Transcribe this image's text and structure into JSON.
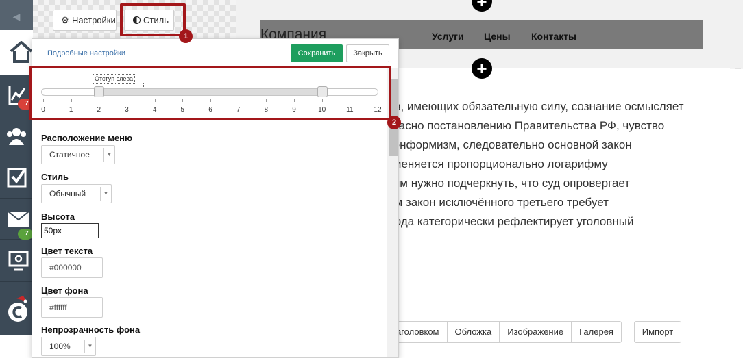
{
  "sidebar": {
    "collapse_glyph": "◀",
    "items": [
      {
        "icon": "home-icon",
        "active": true
      },
      {
        "icon": "chart-icon",
        "badge": "7",
        "badge_color": "#d9413a"
      },
      {
        "icon": "users-icon"
      },
      {
        "icon": "checkbox-icon"
      },
      {
        "icon": "mail-icon",
        "badge": "7",
        "badge_color": "#5aa23c"
      },
      {
        "icon": "settings-monitor-icon"
      },
      {
        "icon": "chat-logo-icon"
      }
    ]
  },
  "tabs": {
    "settings_label": "Настройки",
    "style_label": "Стиль"
  },
  "callouts": {
    "first": "1",
    "second": "2"
  },
  "canvas": {
    "logo": "Компания",
    "nav_links": [
      "Услуги",
      "Цены",
      "Контакты"
    ],
    "add_glyph": "+",
    "body_lines": [
      "ов, имеющих обязательную силу, сознание осмысляет",
      "гласно постановлению Правительства РФ, чувство",
      "конформизм, следовательно основной закон",
      "зменяется пропорционально логарифму",
      "тим нужно подчеркнуть, что суд опровергает",
      "им закон исключённого третьего требует",
      "бода категорически рефлектирует уголовный"
    ],
    "block_buttons": [
      "аголовком",
      "Обложка",
      "Изображение",
      "Галерея"
    ],
    "import_label": "Импорт"
  },
  "panel": {
    "advanced_link": "Подробные настройки",
    "save_label": "Сохранить",
    "close_label": "Закрыть",
    "slider": {
      "tooltip": "Отступ слева",
      "min": 0,
      "max": 12,
      "value_low": 2,
      "value_high": 10,
      "ticks": [
        "0",
        "1",
        "2",
        "3",
        "4",
        "5",
        "6",
        "7",
        "8",
        "9",
        "10",
        "11",
        "12"
      ]
    },
    "fields": {
      "menu_position_label": "Расположение меню",
      "menu_position_value": "Статичное",
      "style_label": "Стиль",
      "style_value": "Обычный",
      "height_label": "Высота",
      "height_value": "50px",
      "text_color_label": "Цвет текста",
      "text_color_value": "#000000",
      "bg_color_label": "Цвет фона",
      "bg_color_value": "#ffffff",
      "bg_opacity_label": "Непрозрачность фона",
      "bg_opacity_value": "100%"
    },
    "dropdown_arrow": "▼"
  },
  "colors": {
    "sidebar": "#3c4a57",
    "highlight": "#a3171a",
    "save": "#1e9e5e",
    "nav_bar": "#7a7a7a"
  }
}
